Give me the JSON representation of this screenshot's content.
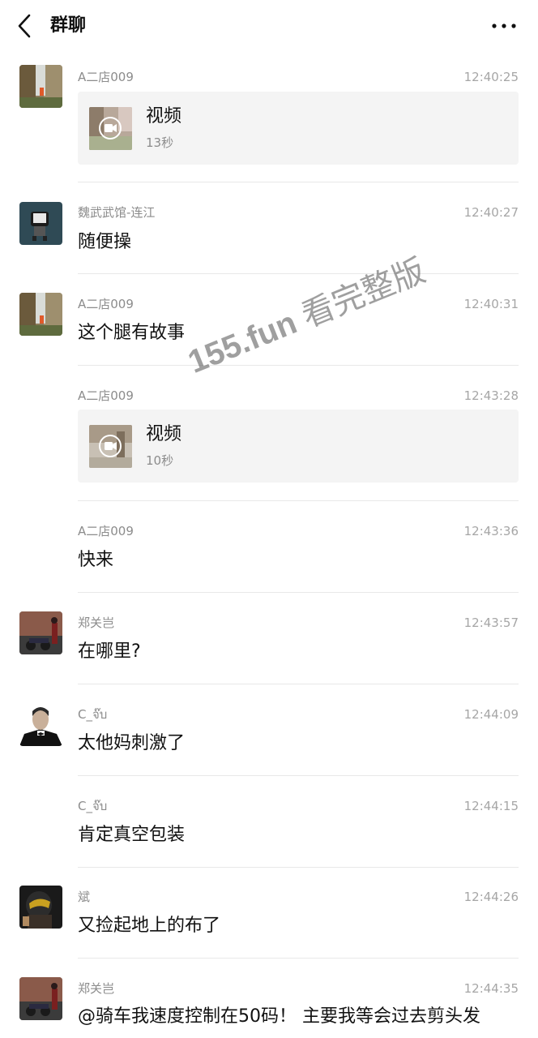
{
  "header": {
    "title": "群聊"
  },
  "messages": [
    {
      "sender": "A二店009",
      "time": "12:40:25",
      "type": "video",
      "video_label": "视频",
      "duration": "13秒"
    },
    {
      "sender": "魏武武馆-连江",
      "time": "12:40:27",
      "type": "text",
      "text": "随便操"
    },
    {
      "sender": "A二店009",
      "time": "12:40:31",
      "type": "text",
      "text": "这个腿有故事"
    },
    {
      "sender": "A二店009",
      "time": "12:43:28",
      "type": "video",
      "video_label": "视频",
      "duration": "10秒"
    },
    {
      "sender": "A二店009",
      "time": "12:43:36",
      "type": "text",
      "text": "快来"
    },
    {
      "sender": "郑关岂",
      "time": "12:43:57",
      "type": "text",
      "text": "在哪里?"
    },
    {
      "sender": "C_จ๊บ",
      "time": "12:44:09",
      "type": "text",
      "text": "太他妈刺激了"
    },
    {
      "sender": "C_จ๊บ",
      "time": "12:44:15",
      "type": "text",
      "text": "肯定真空包装"
    },
    {
      "sender": "斌",
      "time": "12:44:26",
      "type": "text",
      "text": "又捡起地上的布了"
    },
    {
      "sender": "郑关岂",
      "time": "12:44:35",
      "type": "text",
      "text": "@骑车我速度控制在50码！ 主要我等会过去剪头发"
    }
  ],
  "watermark": {
    "domain": "155.fun",
    "text": "看完整版"
  },
  "colors": {
    "sender": "#8c8c8c",
    "time": "#a6a6a6",
    "card_bg": "#f4f4f4",
    "divider": "#e8e8e8"
  }
}
